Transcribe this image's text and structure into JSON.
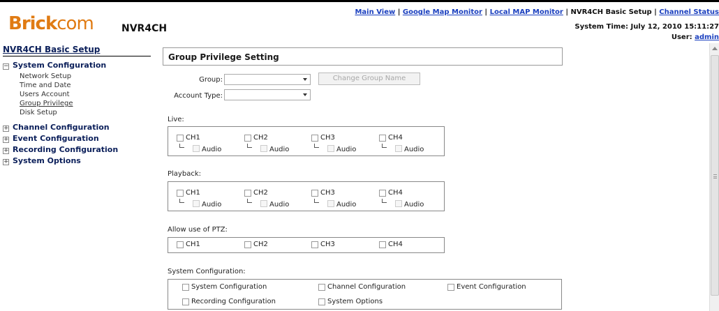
{
  "header": {
    "logo_brick": "Brick",
    "logo_com": "com",
    "model": "NVR4CH",
    "nav": [
      {
        "label": "Main View"
      },
      {
        "label": "Google Map Monitor"
      },
      {
        "label": "Local MAP Monitor"
      },
      {
        "label": "NVR4CH Basic Setup",
        "current": true
      },
      {
        "label": "Channel Status"
      }
    ],
    "separator": " | ",
    "system_time_label": "System Time:",
    "system_time": "July 12, 2010 15:11:27",
    "user_label": "User:",
    "user": "admin"
  },
  "sidebar": {
    "title": "NVR4CH Basic Setup",
    "system_configuration": {
      "label": "System Configuration",
      "toggle": "−",
      "items": [
        "Network Setup",
        "Time and Date",
        "Users Account",
        "Group Privilege",
        "Disk Setup"
      ]
    },
    "groups": [
      {
        "label": "Channel Configuration",
        "toggle": "+"
      },
      {
        "label": "Event Configuration",
        "toggle": "+"
      },
      {
        "label": "Recording Configuration",
        "toggle": "+"
      },
      {
        "label": "System Options",
        "toggle": "+"
      }
    ]
  },
  "main": {
    "title": "Group Privilege Setting",
    "group_label": "Group:",
    "group_value": "",
    "account_type_label": "Account Type:",
    "account_type_value": "",
    "change_group_name_button": "Change Group Name",
    "live_label": "Live:",
    "playback_label": "Playback:",
    "ptz_label": "Allow use of PTZ:",
    "sysconf_label": "System Configuration:",
    "channels": [
      "CH1",
      "CH2",
      "CH3",
      "CH4"
    ],
    "audio_label": "Audio",
    "sysconf_items": [
      "System Configuration",
      "Channel Configuration",
      "Event Configuration",
      "Recording Configuration",
      "System Options"
    ]
  },
  "colors": {
    "brand": "#e07b13",
    "link": "#1a3fbf",
    "nav_heading": "#0b1f5a"
  }
}
